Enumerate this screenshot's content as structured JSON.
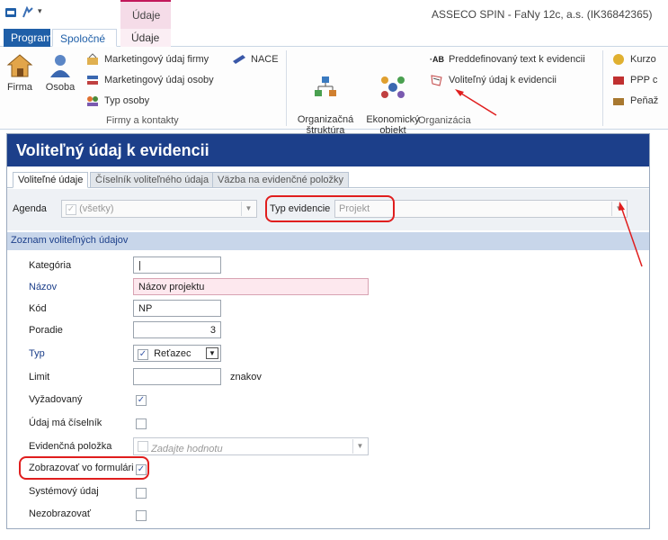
{
  "window": {
    "context_tab": "Údaje",
    "title": "ASSECO SPIN - FaNy 12c, a.s. (IK36842365)"
  },
  "ribbon_tabs": [
    {
      "label": "Program"
    },
    {
      "label": "Spoločné"
    },
    {
      "label": "Údaje"
    }
  ],
  "ribbon": {
    "big_buttons": [
      {
        "label": "Firma",
        "icon": "house-icon"
      },
      {
        "label": "Osoba",
        "icon": "person-icon"
      },
      {
        "label": "Organizačná\nštruktúra",
        "icon": "org-structure-icon"
      },
      {
        "label": "Ekonomický\nobjekt",
        "icon": "economic-object-icon"
      }
    ],
    "small_buttons_firmy": [
      {
        "label": "Marketingový údaj firmy",
        "icon": "marketing-company-icon"
      },
      {
        "label": "Marketingový údaj osoby",
        "icon": "marketing-person-icon"
      },
      {
        "label": "Typ osoby",
        "icon": "people-type-icon"
      }
    ],
    "nace": {
      "label": "NACE",
      "icon": "nace-icon"
    },
    "small_buttons_org": [
      {
        "label": "Preddefinovaný text k evidencii",
        "icon": "ab-text-icon"
      },
      {
        "label": "Voliteľný údaj k evidencii",
        "icon": "optional-data-icon"
      }
    ],
    "small_buttons_right": [
      {
        "label": "Kurzo",
        "icon": "currency-rate-icon"
      },
      {
        "label": "PPP c",
        "icon": "ppp-icon"
      },
      {
        "label": "Peňaž",
        "icon": "money-icon"
      }
    ],
    "groups": [
      {
        "label": "Firmy a kontakty"
      },
      {
        "label": "Organizácia"
      }
    ]
  },
  "document": {
    "title": "Voliteľný údaj k evidencii",
    "tabs": [
      {
        "label": "Voliteľné údaje"
      },
      {
        "label": "Číselník voliteľného údaja"
      },
      {
        "label": "Väzba na evidenčné položky"
      }
    ],
    "filter": {
      "agenda_label": "Agenda",
      "agenda_value": "(všetky)",
      "typ_label": "Typ evidencie",
      "typ_value": "Projekt"
    },
    "section_title": "Zoznam voliteľných údajov",
    "fields": {
      "kategoria": {
        "label": "Kategória",
        "value": "|"
      },
      "nazov": {
        "label": "Názov",
        "value": "Názov projektu"
      },
      "kod": {
        "label": "Kód",
        "value": "NP"
      },
      "poradie": {
        "label": "Poradie",
        "value": "3"
      },
      "typ": {
        "label": "Typ",
        "value": "Reťazec"
      },
      "limit": {
        "label": "Limit",
        "value": "",
        "unit": "znakov"
      },
      "vyzadovany": {
        "label": "Vyžadovaný",
        "checked": true
      },
      "ciselnik": {
        "label": "Údaj má číselník",
        "checked": false
      },
      "evidencna": {
        "label": "Evidenčná položka",
        "placeholder": "Zadajte hodnotu"
      },
      "zobrazovat": {
        "label": "Zobrazovať vo formulári",
        "checked": true
      },
      "systemovy": {
        "label": "Systémový údaj",
        "checked": false
      },
      "nezobrazovat": {
        "label": "Nezobrazovať",
        "checked": false
      }
    }
  },
  "colors": {
    "accent": "#1c3f8a",
    "context_tab": "#c2185b",
    "annotation": "#e01e1e"
  }
}
